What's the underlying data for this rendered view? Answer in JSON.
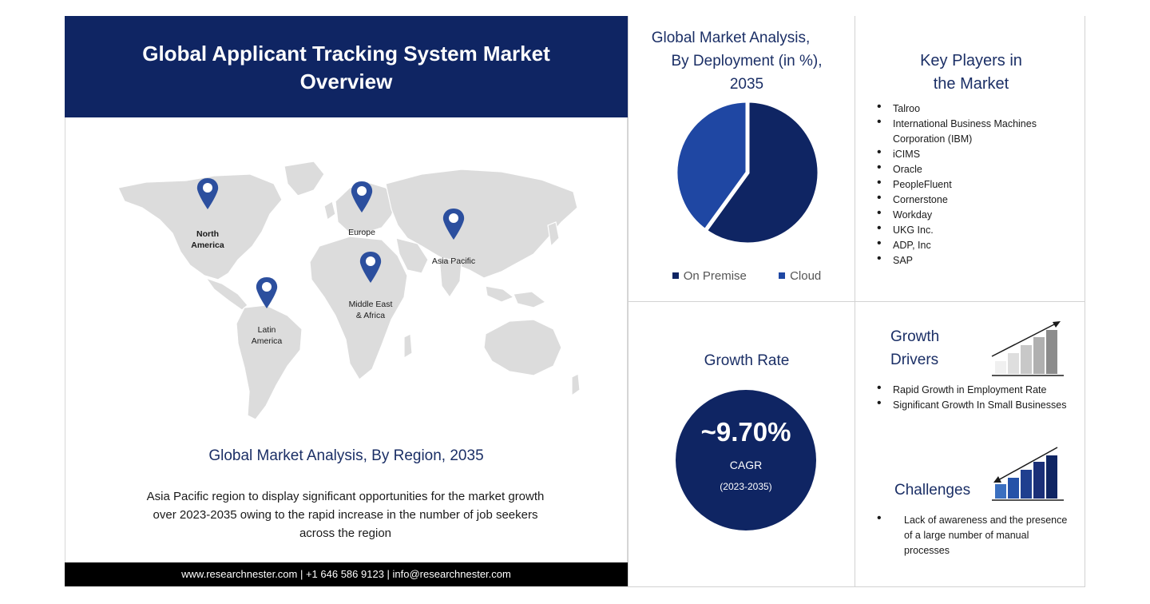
{
  "header": {
    "title_line1": "Global Applicant Tracking System Market",
    "title_line2": "Overview"
  },
  "map": {
    "pins": [
      {
        "id": "north-america",
        "line1": "North",
        "line2": "America"
      },
      {
        "id": "europe",
        "line1": "Europe",
        "line2": ""
      },
      {
        "id": "asia-pacific",
        "line1": "Asia Pacific",
        "line2": ""
      },
      {
        "id": "middle-east-africa",
        "line1": "Middle East",
        "line2": "& Africa"
      },
      {
        "id": "latin-america",
        "line1": "Latin",
        "line2": "America"
      }
    ],
    "pin_color": "#2c4f9e",
    "land_color": "#dcdcdc"
  },
  "region": {
    "title": "Global Market Analysis, By Region, 2035",
    "description": "Asia Pacific region to display significant opportunities for the market growth over 2023-2035 owing to the rapid increase in the number of job seekers across the region"
  },
  "footer": {
    "text": "www.researchnester.com | +1 646 586 9123 | info@researchnester.com"
  },
  "chart_data": {
    "type": "pie",
    "title_line1": "Global Market Analysis,",
    "title_line2": "By Deployment (in %),",
    "title_line3": "2035",
    "categories": [
      "On Premise",
      "Cloud"
    ],
    "values": [
      60,
      40
    ],
    "colors": [
      "#0f2563",
      "#1f47a3"
    ],
    "legend_position": "bottom"
  },
  "key_players": {
    "title_line1": "Key Players in",
    "title_line2": "the Market",
    "items": [
      "Talroo",
      "International Business Machines Corporation (IBM)",
      "iCIMS",
      "Oracle",
      "PeopleFluent",
      "Cornerstone",
      "Workday",
      "UKG Inc.",
      "ADP, Inc",
      "SAP"
    ]
  },
  "growth_rate": {
    "title": "Growth Rate",
    "value": "~9.70%",
    "label": "CAGR",
    "period": "(2023-2035)"
  },
  "growth_drivers": {
    "title_line1": "Growth",
    "title_line2": "Drivers",
    "items": [
      "Rapid Growth in Employment Rate",
      "Significant Growth In Small Businesses"
    ]
  },
  "challenges": {
    "title": "Challenges",
    "items": [
      "Lack of awareness and the presence of a large number of manual processes"
    ]
  },
  "colors": {
    "navy": "#0f2563",
    "accent_blue": "#1b2f66"
  }
}
